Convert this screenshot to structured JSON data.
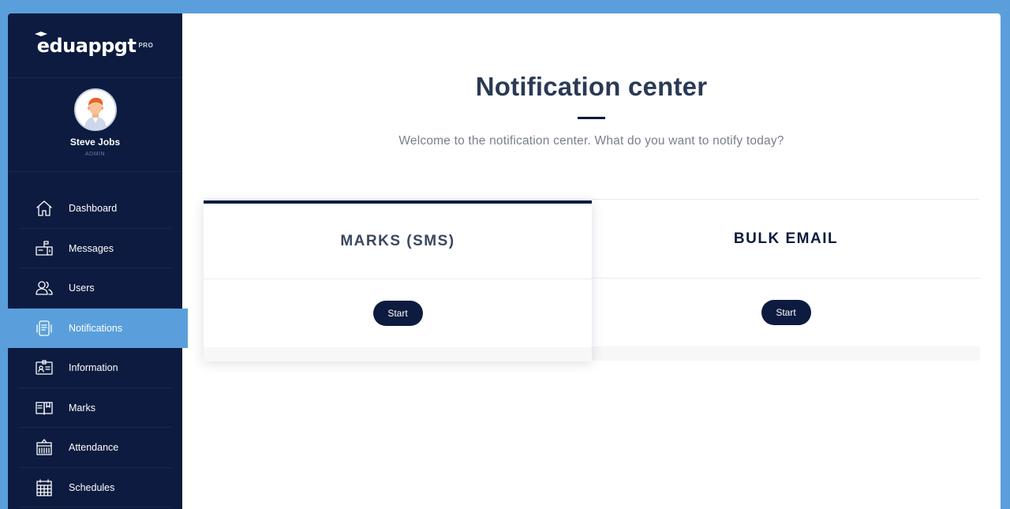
{
  "brand": {
    "name": "eduappgt",
    "tier": "PRO"
  },
  "user": {
    "name": "Steve Jobs",
    "role": "ADMIN"
  },
  "sidebar": {
    "items": [
      {
        "label": "Dashboard",
        "icon": "home-icon"
      },
      {
        "label": "Messages",
        "icon": "mailbox-icon"
      },
      {
        "label": "Users",
        "icon": "users-icon"
      },
      {
        "label": "Notifications",
        "icon": "notifications-icon",
        "active": true
      },
      {
        "label": "Information",
        "icon": "id-card-icon"
      },
      {
        "label": "Marks",
        "icon": "book-icon"
      },
      {
        "label": "Attendance",
        "icon": "attendance-board-icon"
      },
      {
        "label": "Schedules",
        "icon": "calendar-icon"
      }
    ]
  },
  "main": {
    "title": "Notification center",
    "subtitle": "Welcome to the notification center. What do you want to notify today?",
    "cards": [
      {
        "title": "MARKS (SMS)",
        "button": "Start"
      },
      {
        "title": "BULK EMAIL",
        "button": "Start"
      }
    ]
  },
  "colors": {
    "sidebar_bg": "#0c1b3f",
    "accent": "#5a9fdb",
    "button_bg": "#0c1b3f",
    "title_text": "#2b3a55"
  }
}
